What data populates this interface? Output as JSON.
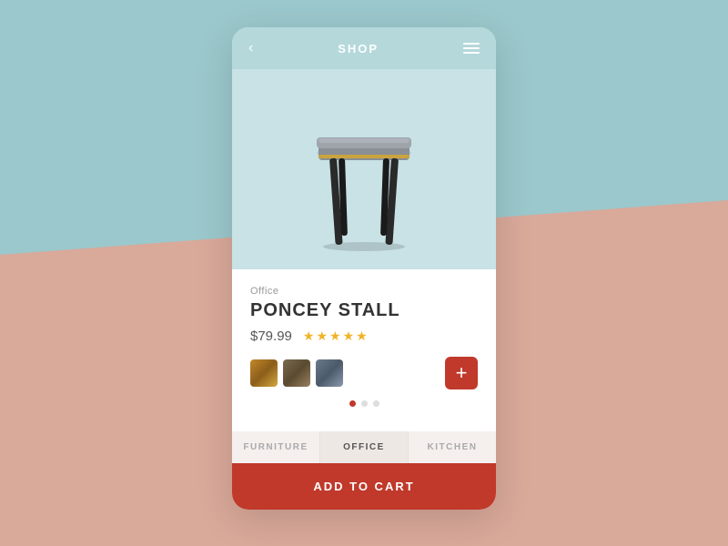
{
  "background": {
    "top_color": "#9bc8cc",
    "bottom_color": "#d9a99a"
  },
  "header": {
    "title": "SHOP",
    "back_label": "‹",
    "menu_icon": "menu-icon"
  },
  "product": {
    "category": "Office",
    "name": "PONCEY STALL",
    "price": "$79.99",
    "stars": 4.5,
    "swatches": [
      {
        "id": 1,
        "label": "warm-wood"
      },
      {
        "id": 2,
        "label": "dark-wood"
      },
      {
        "id": 3,
        "label": "grey-fabric"
      }
    ]
  },
  "dots": [
    {
      "active": true
    },
    {
      "active": false
    },
    {
      "active": false
    }
  ],
  "categories": [
    {
      "label": "FURNITURE",
      "active": false
    },
    {
      "label": "OFFICE",
      "active": true
    },
    {
      "label": "KITCHEN",
      "active": false
    }
  ],
  "add_to_cart": {
    "label": "ADD TO CART"
  }
}
